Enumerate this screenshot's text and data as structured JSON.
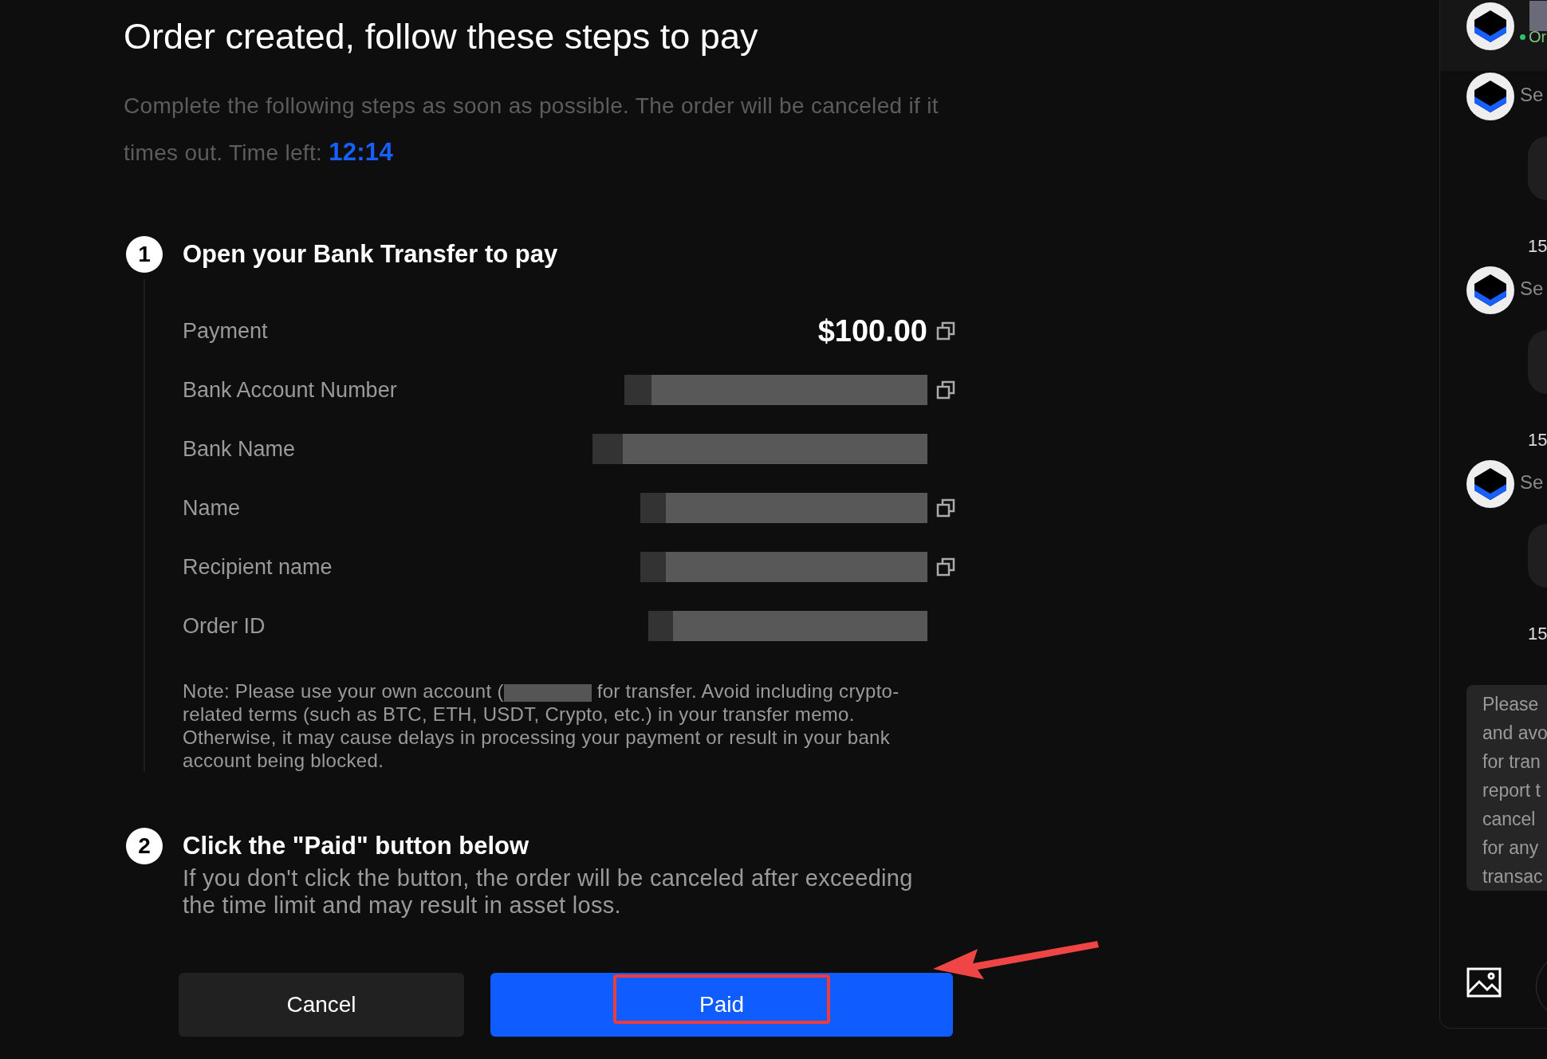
{
  "title": "Order created, follow these steps to pay",
  "subtitle": "Complete the following steps as soon as possible. The order will be canceled if it times out. Time left:",
  "timer": "12:14",
  "steps": [
    {
      "number": "1",
      "title": "Open your Bank Transfer to pay",
      "rows": [
        {
          "label": "Payment",
          "kind": "amount",
          "value": "$100.00",
          "copyable": true
        },
        {
          "label": "Bank Account Number",
          "kind": "redacted",
          "copyable": true
        },
        {
          "label": "Bank Name",
          "kind": "redacted",
          "copyable": false
        },
        {
          "label": "Name",
          "kind": "redacted",
          "copyable": true
        },
        {
          "label": "Recipient name",
          "kind": "redacted",
          "copyable": true
        },
        {
          "label": "Order ID",
          "kind": "redacted",
          "copyable": false
        }
      ],
      "note_before": "Note: Please use your own account (",
      "note_after": "for transfer. Avoid including crypto-related terms (such as BTC, ETH, USDT, Crypto, etc.) in your transfer memo. Otherwise, it may cause delays in processing your payment or result in your bank account being blocked."
    },
    {
      "number": "2",
      "title": "Click the \"Paid\" button below",
      "description": "If you don't click the button, the order will be canceled after exceeding the time limit and may result in asset loss."
    }
  ],
  "buttons": [
    {
      "label": "Cancel",
      "kind": "secondary",
      "highlighted": false
    },
    {
      "label": "Paid",
      "kind": "primary",
      "highlighted": true
    }
  ],
  "chat": {
    "status": "Or",
    "messages": [
      {
        "sender": "Se",
        "time": "15"
      },
      {
        "sender": "Se",
        "time": "15"
      },
      {
        "sender": "Se",
        "time": "15"
      }
    ],
    "notice": [
      "Please",
      "and avo",
      "for tran",
      "report t",
      "cancel",
      "for any",
      "transac"
    ]
  }
}
